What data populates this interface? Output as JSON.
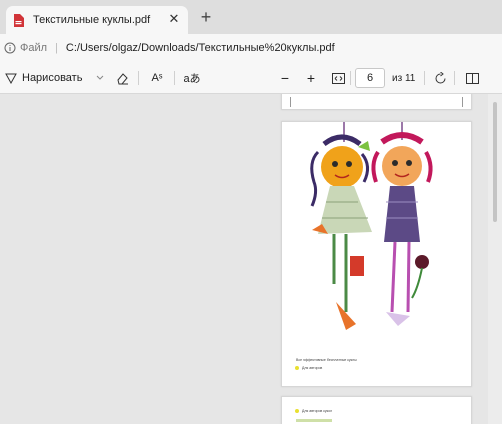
{
  "tab": {
    "title": "Текстильные куклы.pdf",
    "close": "✕"
  },
  "newtab": {
    "label": "+"
  },
  "address": {
    "scheme": "Файл",
    "separator": "|",
    "url": "C:/Users/olgaz/Downloads/Текстильные%20куклы.pdf"
  },
  "toolbar": {
    "draw_label": "Нарисовать",
    "zoom_out": "−",
    "zoom_in": "+",
    "page_current": "6",
    "page_total": "из 11",
    "read_aloud": "Aˢ",
    "translate": "aあ"
  },
  "document": {
    "caption": "Все эффективные бесплатные куклы",
    "caption_sub": "Для авторов",
    "next_caption": "Для авторов кукол"
  },
  "colors": {
    "accent": "#c42b1c",
    "pdf_red": "#d13438"
  }
}
